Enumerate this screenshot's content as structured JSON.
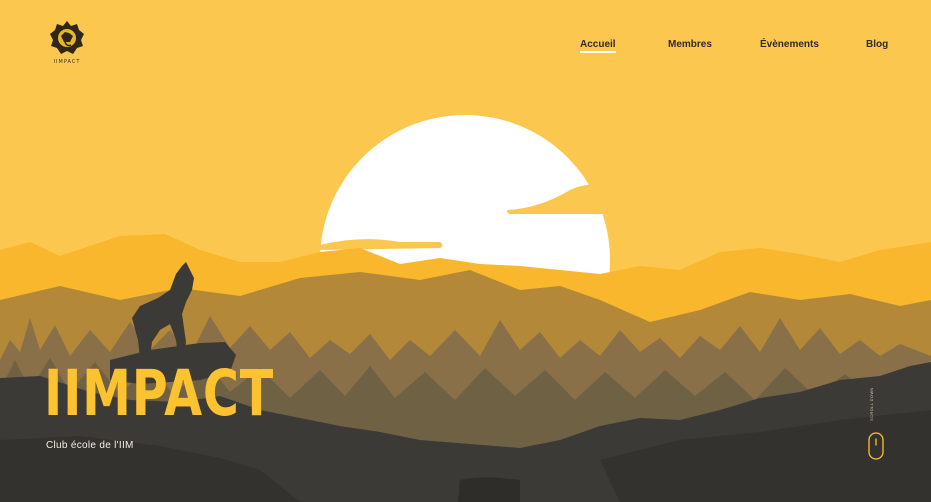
{
  "header": {
    "logo_text": "IIMPACT",
    "nav": [
      {
        "label": "Accueil",
        "active": true
      },
      {
        "label": "Membres",
        "active": false
      },
      {
        "label": "Évènements",
        "active": false
      },
      {
        "label": "Blog",
        "active": false
      }
    ]
  },
  "hero": {
    "title": "IIMPACT",
    "subtitle": "Club école de l'IIM"
  },
  "scroll": {
    "label": "SCROLL DOWN",
    "icon": "mouse-icon"
  },
  "icons": {
    "logo": "wolf-logo-icon"
  },
  "colors": {
    "sky": "#fcc74f",
    "sun": "#ffffff",
    "far_mountains": "#f8b72c",
    "mid_mountains": "#b38838",
    "trees_far": "#8a7049",
    "trees_near": "#7a6a4a",
    "foreground": "#3b3a36",
    "accent": "#fcc230"
  }
}
